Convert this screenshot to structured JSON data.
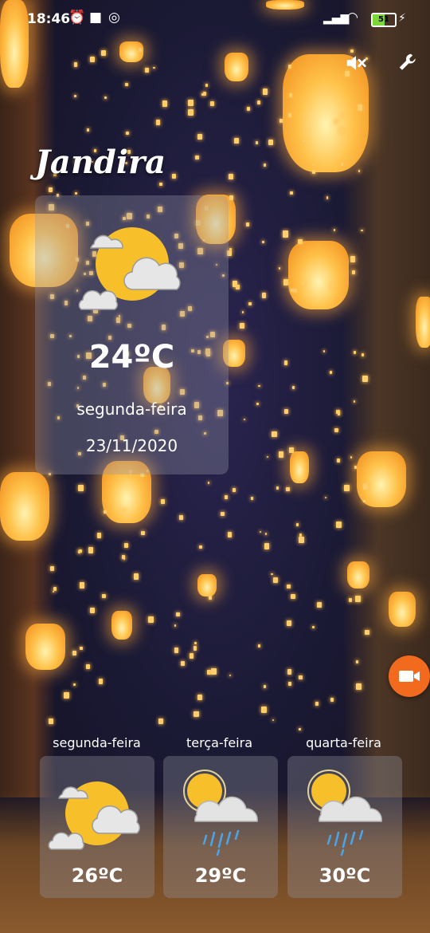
{
  "statusbar": {
    "time": "18:46",
    "battery": "51"
  },
  "header": {
    "city": "Jandira",
    "mute_icon": "volume-mute-icon",
    "settings_icon": "wrench-icon"
  },
  "current": {
    "icon": "partly-cloudy-sun-icon",
    "temperature": "24ºC",
    "weekday": "segunda-feira",
    "date": "23/11/2020"
  },
  "forecast": [
    {
      "weekday": "segunda-feira",
      "temperature": "26ºC",
      "icon": "partly-cloudy-sun-icon"
    },
    {
      "weekday": "terça-feira",
      "temperature": "29ºC",
      "icon": "sun-cloud-rain-icon"
    },
    {
      "weekday": "quarta-feira",
      "temperature": "30ºC",
      "icon": "sun-cloud-rain-icon"
    }
  ],
  "fab": {
    "icon": "video-camera-icon",
    "color": "#f26a1e"
  }
}
